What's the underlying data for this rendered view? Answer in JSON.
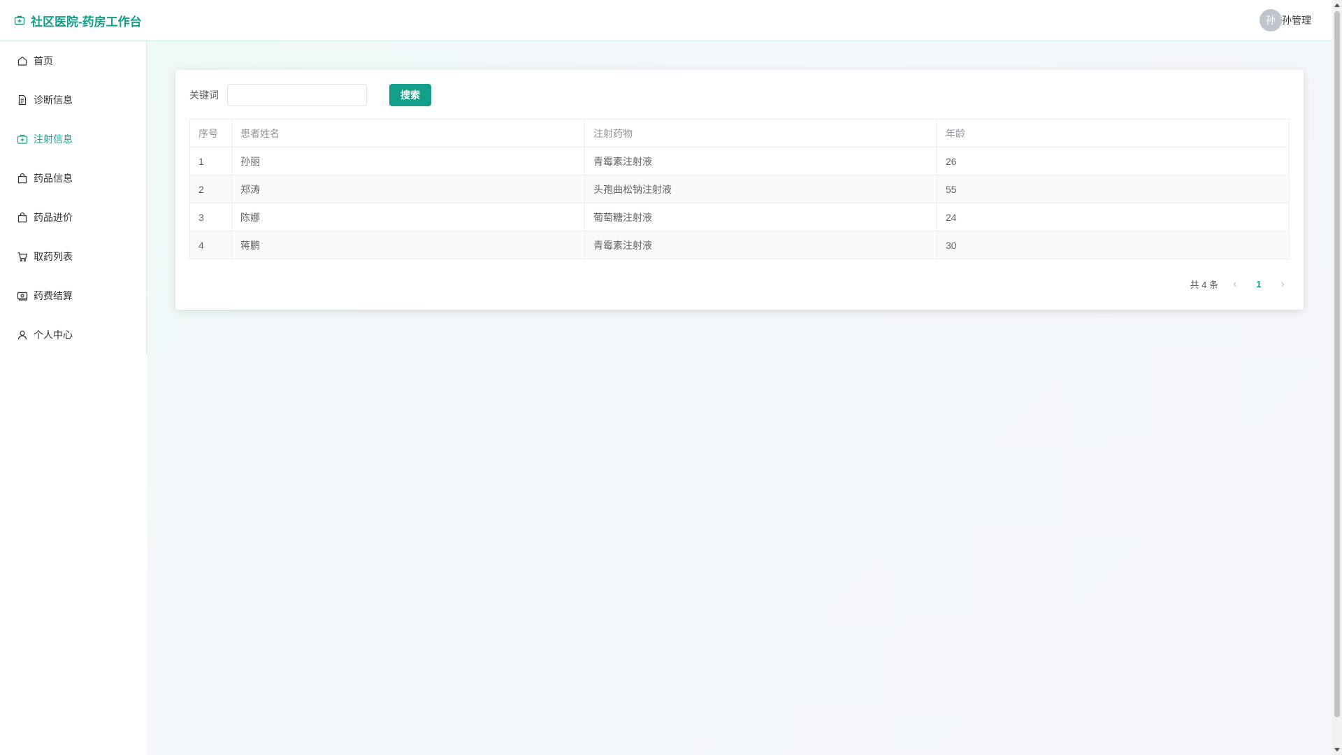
{
  "header": {
    "title": "社区医院-药房工作台",
    "user": {
      "avatar_text": "孙",
      "name": "孙管理"
    }
  },
  "sidebar": {
    "items": [
      {
        "label": "首页",
        "icon": "house-icon",
        "active": false
      },
      {
        "label": "诊断信息",
        "icon": "document-icon",
        "active": false
      },
      {
        "label": "注射信息",
        "icon": "first-aid-kit-icon",
        "active": true
      },
      {
        "label": "药品信息",
        "icon": "shopping-bag-icon",
        "active": false
      },
      {
        "label": "药品进价",
        "icon": "shopping-bag-icon",
        "active": false
      },
      {
        "label": "取药列表",
        "icon": "shopping-cart-icon",
        "active": false
      },
      {
        "label": "药费结算",
        "icon": "money-icon",
        "active": false
      },
      {
        "label": "个人中心",
        "icon": "user-icon",
        "active": false
      }
    ]
  },
  "search": {
    "label": "关键词",
    "value": "",
    "placeholder": "",
    "button_label": "搜索"
  },
  "table": {
    "headers": [
      "序号",
      "患者姓名",
      "注射药物",
      "年龄"
    ],
    "rows": [
      [
        "1",
        "孙丽",
        "青霉素注射液",
        "26"
      ],
      [
        "2",
        "郑涛",
        "头孢曲松钠注射液",
        "55"
      ],
      [
        "3",
        "陈娜",
        "葡萄糖注射液",
        "24"
      ],
      [
        "4",
        "蒋鹏",
        "青霉素注射液",
        "30"
      ]
    ]
  },
  "pagination": {
    "total_text": "共 4 条",
    "current_page": "1",
    "prev": "‹",
    "next": "›"
  },
  "colors": {
    "accent": "#129f89",
    "header_border": "#cdeee6",
    "text": "#606266"
  }
}
